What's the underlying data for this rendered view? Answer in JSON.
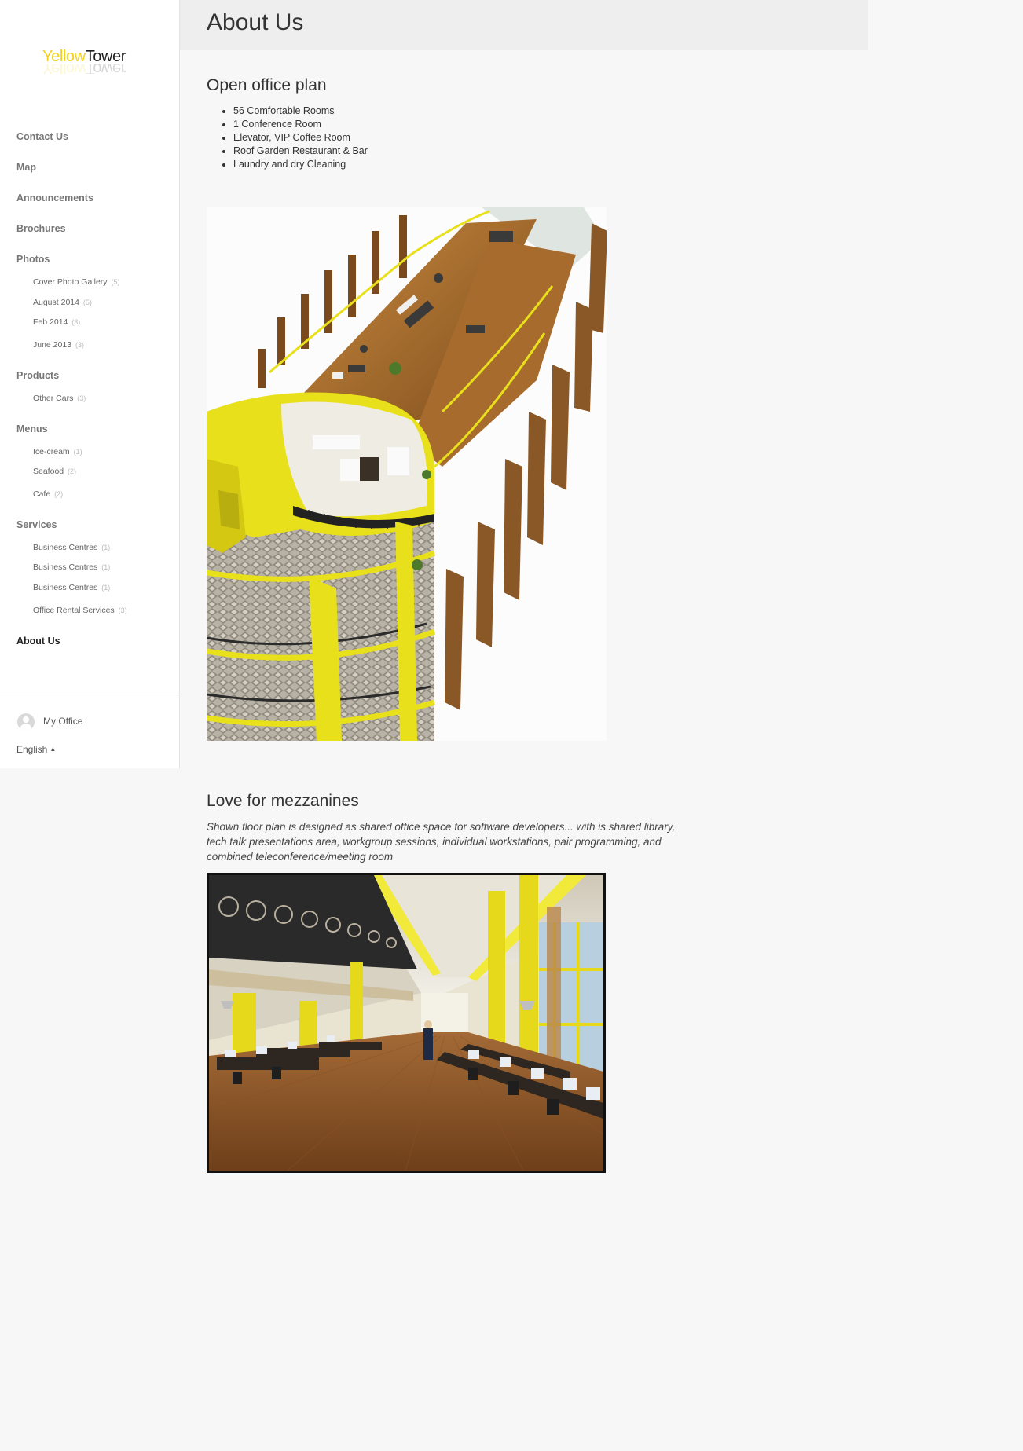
{
  "brand": {
    "logo_part1": "Yellow",
    "logo_part2": "Tower"
  },
  "sidebar": {
    "nav": [
      {
        "label": "Contact Us"
      },
      {
        "label": "Map"
      },
      {
        "label": "Announcements"
      },
      {
        "label": "Brochures"
      },
      {
        "label": "Photos",
        "children": [
          {
            "label": "Cover Photo Gallery",
            "count": "(5)"
          },
          {
            "label": "August 2014",
            "count": "(5)"
          },
          {
            "label": "Feb 2014",
            "count": "(3)"
          },
          {
            "label": "June 2013",
            "count": "(3)"
          }
        ]
      },
      {
        "label": "Products",
        "children": [
          {
            "label": "Other Cars",
            "count": "(3)"
          }
        ]
      },
      {
        "label": "Menus",
        "children": [
          {
            "label": "Ice-cream",
            "count": "(1)"
          },
          {
            "label": "Seafood",
            "count": "(2)"
          },
          {
            "label": "Cafe",
            "count": "(2)"
          }
        ]
      },
      {
        "label": "Services",
        "children": [
          {
            "label": "Business Centres",
            "count": "(1)"
          },
          {
            "label": "Business Centres",
            "count": "(1)"
          },
          {
            "label": "Business Centres",
            "count": "(1)"
          },
          {
            "label": "Office Rental Services",
            "count": "(3)"
          }
        ]
      },
      {
        "label": "About Us",
        "active": true
      }
    ],
    "footer": {
      "my_office": "My Office",
      "language": "English",
      "language_caret": "▲"
    }
  },
  "header": {
    "title": "About Us"
  },
  "section1": {
    "heading": "Open office plan",
    "features": [
      "56 Comfortable Rooms",
      "1 Conference Room",
      "Elevator, VIP Coffee Room",
      "Roof Garden Restaurant & Bar",
      "Laundry and dry Cleaning"
    ]
  },
  "section2": {
    "heading": "Love for mezzanines",
    "description": "Shown floor plan is designed as shared office space for software developers... with is shared library, tech talk presentations area, workgroup sessions, individual workstations, pair programming, and combined teleconference/meeting room"
  },
  "colors": {
    "brand_yellow": "#f2d21a",
    "building_yellow": "#e8e01a",
    "wood": "#a8682a"
  }
}
